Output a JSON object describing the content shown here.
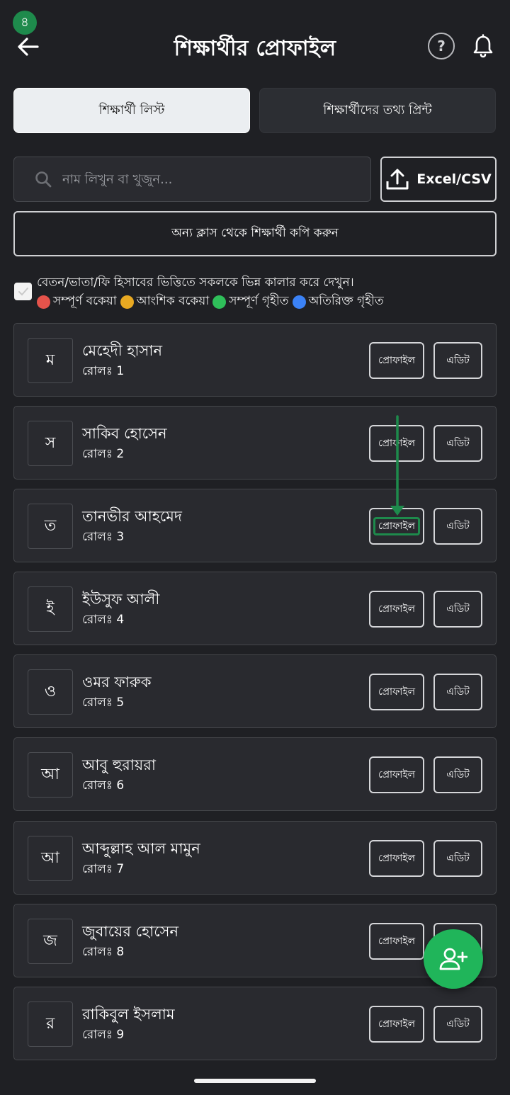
{
  "step_badge": "৪",
  "header": {
    "title": "শিক্ষার্থীর প্রোফাইল",
    "back_icon": "arrow-left-icon",
    "help_label": "?",
    "bell_icon": "bell-icon"
  },
  "tabs": [
    {
      "label": "শিক্ষার্থী লিস্ট",
      "active": true
    },
    {
      "label": "শিক্ষার্থীদের তথ্য প্রিন্ট",
      "active": false
    }
  ],
  "search": {
    "placeholder": "নাম লিখুন বা খুজুন...",
    "value": ""
  },
  "excel_button": {
    "label": "Excel/CSV",
    "icon": "upload-icon"
  },
  "copy_button": {
    "label": "অন্য ক্লাস থেকে শিক্ষার্থী কপি করুন"
  },
  "legend": {
    "checked": true,
    "text": "বেতন/ভাতা/ফি হিসাবের ভিত্তিতে সকলকে ভিন্ন কালার করে দেখুন।",
    "items": [
      {
        "label": "সম্পূর্ণ বকেয়া",
        "color": "#e5534b"
      },
      {
        "label": "আংশিক বকেয়া",
        "color": "#e8a922"
      },
      {
        "label": "সম্পূর্ণ গৃহীত",
        "color": "#2fbf5a"
      },
      {
        "label": "অতিরিক্ত গৃহীত",
        "color": "#3b82f6"
      }
    ]
  },
  "buttons": {
    "profile": "প্রোফাইল",
    "edit": "এডিট"
  },
  "students": [
    {
      "initial": "ম",
      "name": "মেহেদী হাসান",
      "roll": "রোলঃ 1"
    },
    {
      "initial": "স",
      "name": "সাকিব হোসেন",
      "roll": "রোলঃ 2"
    },
    {
      "initial": "ত",
      "name": "তানভীর আহমেদ",
      "roll": "রোলঃ 3"
    },
    {
      "initial": "ই",
      "name": "ইউসুফ আলী",
      "roll": "রোলঃ 4"
    },
    {
      "initial": "ও",
      "name": "ওমর ফারুক",
      "roll": "রোলঃ 5"
    },
    {
      "initial": "আ",
      "name": "আবু হুরায়রা",
      "roll": "রোলঃ 6"
    },
    {
      "initial": "আ",
      "name": "আব্দুল্লাহ আল মামুন",
      "roll": "রোলঃ 7"
    },
    {
      "initial": "জ",
      "name": "জুবায়ের হোসেন",
      "roll": "রোলঃ 8"
    },
    {
      "initial": "র",
      "name": "রাকিবুল ইসলাম",
      "roll": "রোলঃ 9"
    }
  ],
  "fab": {
    "icon": "add-user-icon"
  },
  "accent_color": "#1e8a4c"
}
